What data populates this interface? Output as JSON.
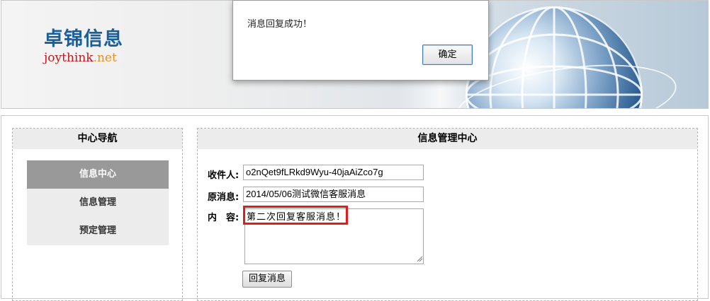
{
  "header": {
    "logo_cn": "卓锦信息",
    "logo_en_name": "joythink",
    "logo_en_tld": ".net"
  },
  "sidebar": {
    "title": "中心导航",
    "items": [
      {
        "label": "信息中心",
        "active": true
      },
      {
        "label": "信息管理",
        "active": false
      },
      {
        "label": "预定管理",
        "active": false
      }
    ]
  },
  "content": {
    "title": "信息管理中心",
    "recipient_label": "收件人:",
    "recipient_value": "o2nQet9fLRkd9Wyu-40jaAiZco7g",
    "original_label": "原消息:",
    "original_value": "2014/05/06测试微信客服消息",
    "content_label": "内　容:",
    "content_value": "第二次回复客服消息！",
    "reply_button": "回复消息"
  },
  "alert": {
    "message": "消息回复成功！",
    "ok_button": "确定"
  },
  "colors": {
    "logo_blue": "#1a5f9b",
    "logo_red": "#c5161d",
    "logo_orange": "#e8901e",
    "nav_active": "#999999",
    "highlight_red": "#e21b1b"
  }
}
